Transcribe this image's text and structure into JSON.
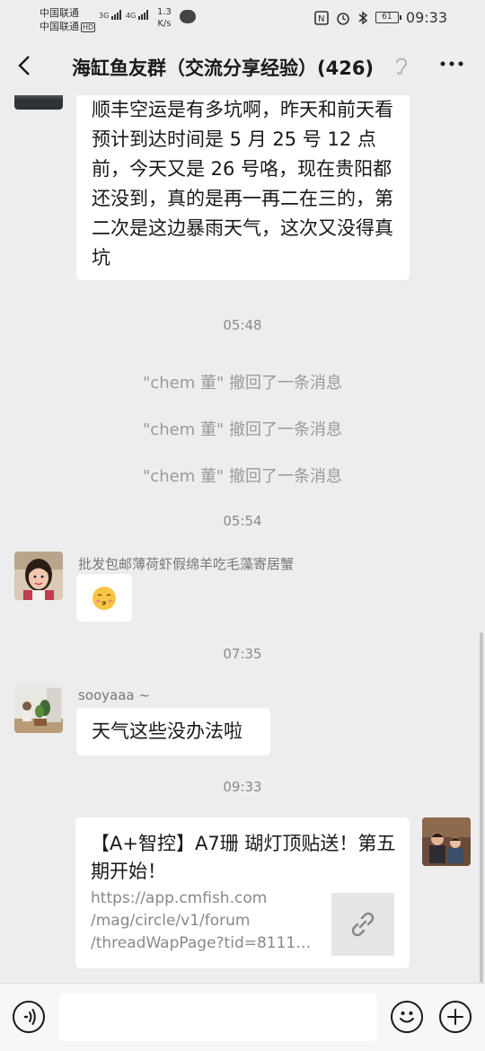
{
  "status_bar": {
    "carrier1": "中国联通",
    "carrier2": "中国联通",
    "hd": "HD",
    "sig1": "3G",
    "sig2": "4G",
    "net_speed_value": "1.3",
    "net_speed_unit": "K/s",
    "battery": "61",
    "time": "09:33"
  },
  "nav": {
    "title": "海缸鱼友群（交流分享经验）(426)"
  },
  "messages": {
    "m1_text": "顺丰空运是有多坑啊，昨天和前天看预计到达时间是 5 月 25 号 12 点前，今天又是 26 号咯，现在贵阳都还没到，真的是再一再二在三的，第二次是这边暴雨天气，这次又没得真坑",
    "time1": "05:48",
    "recall1": "\"chem 董\" 撤回了一条消息",
    "recall2": "\"chem 董\" 撤回了一条消息",
    "recall3": "\"chem 董\" 撤回了一条消息",
    "time2": "05:54",
    "m2_sender": "批发包邮薄荷虾假绵羊吃毛藻寄居蟹",
    "m2_emoji": "😚",
    "time3": "07:35",
    "m3_sender": "sooyaaa ~",
    "m3_text": "天气这些没办法啦",
    "time4": "09:33",
    "link_title": "【A+智控】A7珊 瑚灯顶贴送！第五期开始！",
    "link_url_1": "https://app.cmfish.com",
    "link_url_2": "/mag/circle/v1/forum",
    "link_url_3": "/threadWapPage?tid=81119..."
  },
  "icons": {
    "back": "chevron-left-icon",
    "ear": "ear-icon",
    "more": "more-icon",
    "link": "link-icon",
    "voice": "voice-icon",
    "emoji": "emoji-icon",
    "plus": "plus-icon"
  }
}
